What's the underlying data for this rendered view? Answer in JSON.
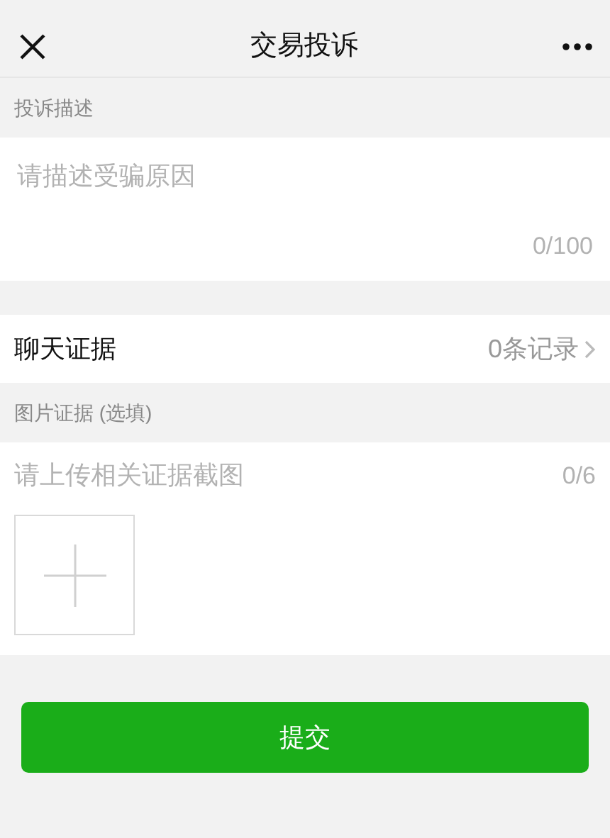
{
  "nav": {
    "title": "交易投诉"
  },
  "description": {
    "label": "投诉描述",
    "placeholder": "请描述受骗原因",
    "counter": "0/100"
  },
  "chat_evidence": {
    "label": "聊天证据",
    "value": "0条记录"
  },
  "image_evidence": {
    "label": "图片证据 (选填)",
    "hint": "请上传相关证据截图",
    "counter": "0/6"
  },
  "submit": {
    "label": "提交"
  }
}
